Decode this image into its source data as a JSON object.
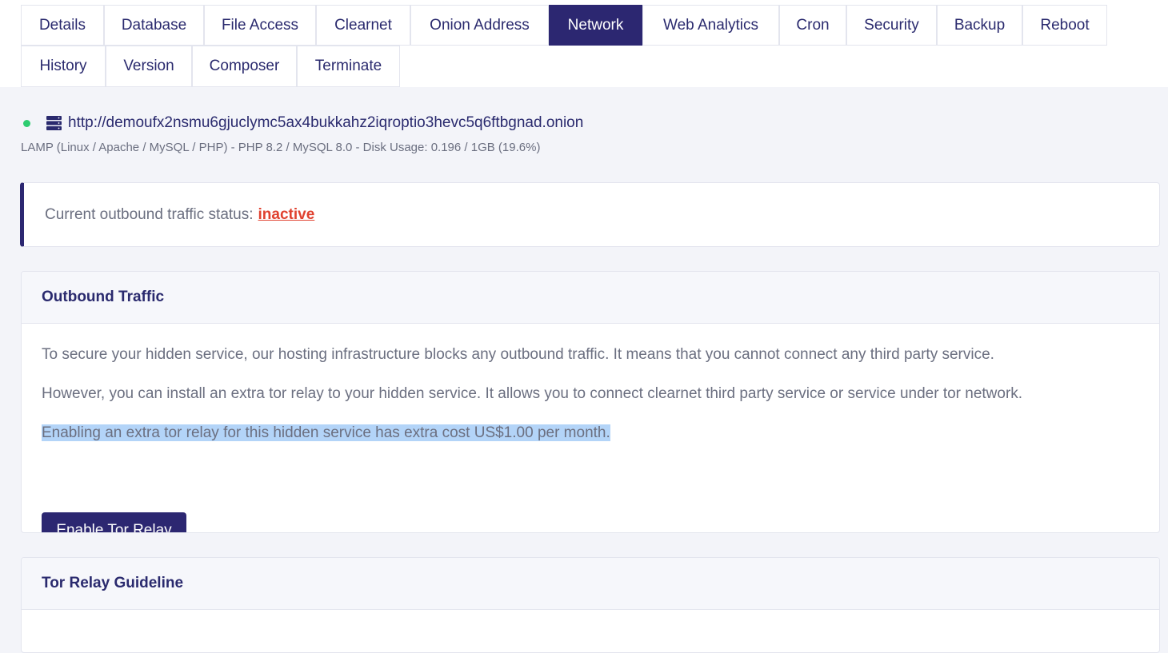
{
  "tabs": {
    "row1": [
      "Details",
      "Database",
      "File Access",
      "Clearnet",
      "Onion Address",
      "Network",
      "Web Analytics",
      "Cron",
      "Security",
      "Backup",
      "Reboot"
    ],
    "row2": [
      "History",
      "Version",
      "Composer",
      "Terminate"
    ],
    "active": "Network"
  },
  "server": {
    "url": "http://demoufx2nsmu6gjuclymc5ax4bukkahz2iqroptio3hevc5q6ftbgnad.onion",
    "stack_info": "LAMP (Linux / Apache / MySQL / PHP) - PHP 8.2 / MySQL 8.0 - Disk Usage: 0.196 / 1GB (19.6%)",
    "status_dot_color": "#2ecc71"
  },
  "alert": {
    "label": "Current outbound traffic status:",
    "status": "inactive",
    "status_color": "#e0412f"
  },
  "outbound_card": {
    "title": "Outbound Traffic",
    "para1": "To secure your hidden service, our hosting infrastructure blocks any outbound traffic. It means that you cannot connect any third party service.",
    "para2": "However, you can install an extra tor relay to your hidden service. It allows you to connect clearnet third party service or service under tor network.",
    "para3": "Enabling an extra tor relay for this hidden service has extra cost US$1.00 per month.",
    "button_label": "Enable Tor Relay"
  },
  "guideline_card": {
    "title": "Tor Relay Guideline"
  },
  "colors": {
    "brand": "#2c2771",
    "background": "#f3f4f9",
    "highlight": "#b3d4f8"
  },
  "icons": {
    "server": "server-icon"
  }
}
